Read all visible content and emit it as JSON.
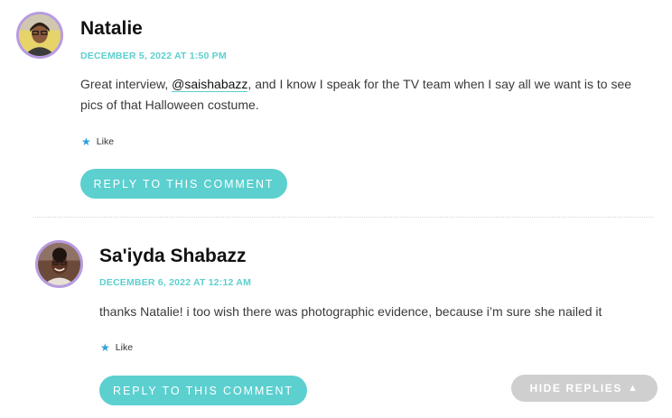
{
  "comments": [
    {
      "author": "Natalie",
      "date": "December 5, 2022 at 1:50 pm",
      "text_before": "Great interview, ",
      "mention": "@saishabazz",
      "text_after": ", and I know I speak for the TV team when I say all we want is to see pics of that Halloween costume.",
      "like_label": "Like",
      "reply_label": "Reply to this comment"
    },
    {
      "author": "Sa'iyda Shabazz",
      "date": "December 6, 2022 at 12:12 am",
      "text": "thanks Natalie! i too wish there was photographic evidence, because i’m sure she nailed it",
      "like_label": "Like",
      "reply_label": "Reply to this comment"
    }
  ],
  "hide_replies_label": "Hide Replies",
  "colors": {
    "accent": "#5ccfcf",
    "avatar_ring": "#b79be0",
    "like_star": "#2f9fd9",
    "hide_button": "#cfcfcf"
  },
  "icons": {
    "like": "star-icon",
    "hide": "caret-up-icon"
  }
}
